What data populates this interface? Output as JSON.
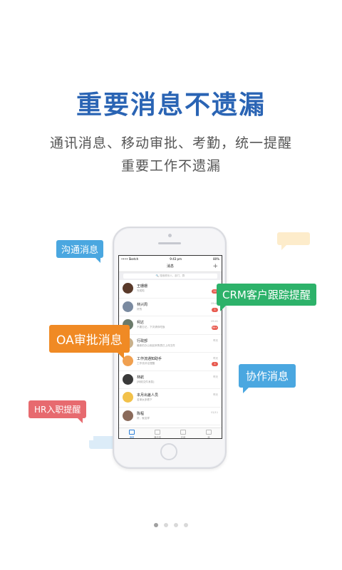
{
  "headline": "重要消息不遗漏",
  "subline1": "通讯消息、移动审批、考勤，统一提醒",
  "subline2": "重要工作不遗漏",
  "phone": {
    "status_carrier": "•••• Sketch",
    "status_time": "9:43 pm",
    "status_battery": "80%",
    "nav_title": "消息",
    "search_placeholder": "🔍 搜索联系人、部门、群",
    "messages": [
      {
        "name": "王珊珊",
        "preview": "完成啦",
        "time": "",
        "badge": "22",
        "color": "#5a3a2a"
      },
      {
        "name": "林兴周",
        "preview": "好的",
        "time": "09:41",
        "badge": "3",
        "color": "#7a8aa0"
      },
      {
        "name": "柯达",
        "preview": "不要忘记，下次请你吃饭",
        "time": "09:41",
        "badge": "99+",
        "color": "#6b7a6a"
      },
      {
        "name": "行政部",
        "preview": "最新的办公用品采购表已上传文件",
        "time": "昨天",
        "badge": "",
        "color": "#c9b08a"
      },
      {
        "name": "工作流通知助手",
        "preview": "工作流评论提醒",
        "time": "昨天",
        "badge": "3",
        "color": "#f0a050"
      },
      {
        "name": "林航",
        "preview": "[网络文件消息]",
        "time": "昨天",
        "badge": "",
        "color": "#3a3a3a"
      },
      {
        "name": "本月出差人员",
        "preview": "名单太多看下",
        "time": "昨天",
        "badge": "",
        "color": "#f2c14a"
      },
      {
        "name": "陈程",
        "preview": "好，就这样",
        "time": "01/11",
        "badge": "",
        "color": "#8a6a5a"
      }
    ],
    "tabs": [
      "消息",
      "通讯录",
      "应用",
      "我"
    ]
  },
  "bubbles": {
    "goutong": "沟通消息",
    "crm": "CRM客户跟踪提醒",
    "oa": "OA审批消息",
    "xiezuo": "协作消息",
    "hr": "HR入职提醒"
  },
  "page_indicator": {
    "count": 4,
    "active": 0
  }
}
